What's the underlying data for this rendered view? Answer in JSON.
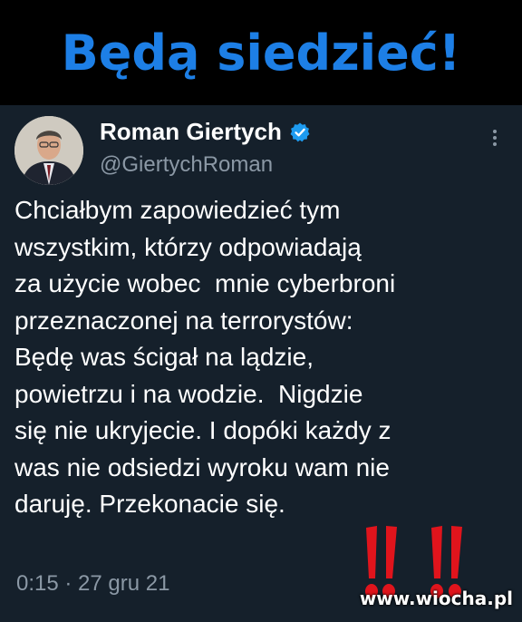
{
  "headline": "Będą siedzieć!",
  "tweet": {
    "author_name": "Roman Giertych",
    "handle": "@GiertychRoman",
    "text": "Chciałbym zapowiedzieć tym\nwszystkim, którzy odpowiadają\nza użycie wobec  mnie cyberbroni\nprzeznaczonej na terrorystów:\nBędę was ścigał na lądzie,\npowietrzu i na wodzie.  Nigdzie\nsię nie ukryjecie. I dopóki każdy z\nwas nie odsiedzi wyroku wam nie\ndaruję. Przekonacie się.",
    "timestamp": "0:15 · 27 gru 21"
  },
  "watermark": "www.wiocha.pl",
  "icons": {
    "verified": "verified-badge-icon",
    "menu": "more-options-icon",
    "exclamation": "double-exclamation-icon"
  },
  "colors": {
    "headline": "#1d7fe6",
    "tweet_bg": "#15202b",
    "verified": "#1d9bf0",
    "secondary_text": "#8b98a5",
    "exclamation": "#e0141c"
  }
}
